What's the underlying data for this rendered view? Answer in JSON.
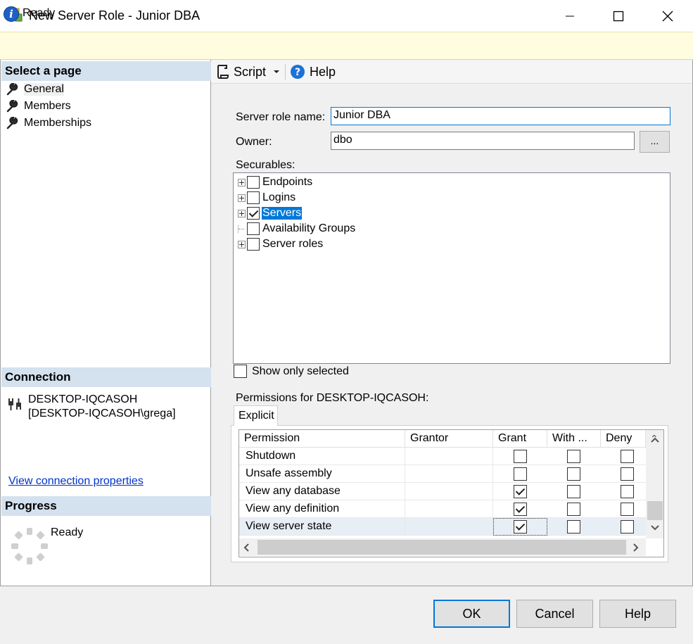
{
  "window": {
    "title": "New Server Role - Junior DBA",
    "controls": [
      "minimize",
      "maximize",
      "close"
    ]
  },
  "status": {
    "text": "Ready",
    "icon": "info-icon"
  },
  "left_panel": {
    "select_page_header": "Select a page",
    "pages": [
      {
        "label": "General",
        "icon": "wrench-icon",
        "selected": true
      },
      {
        "label": "Members",
        "icon": "wrench-icon"
      },
      {
        "label": "Memberships",
        "icon": "wrench-icon"
      }
    ],
    "connection_header": "Connection",
    "connection": {
      "server": "DESKTOP-IQCASOH",
      "user": "[DESKTOP-IQCASOH\\grega]",
      "icon": "connection-plug-icon"
    },
    "view_connection_link": "View connection properties",
    "progress_header": "Progress",
    "progress_status": "Ready"
  },
  "toolbar": {
    "script_label": "Script",
    "help_label": "Help"
  },
  "form": {
    "role_name_label": "Server role name:",
    "role_name_value": "Junior DBA",
    "owner_label": "Owner:",
    "owner_value": "dbo",
    "browse_label": "...",
    "securables_label": "Securables:",
    "securables": [
      {
        "label": "Endpoints",
        "checked": false,
        "expandable": true,
        "selected": false
      },
      {
        "label": "Logins",
        "checked": false,
        "expandable": true,
        "selected": false
      },
      {
        "label": "Servers",
        "checked": true,
        "expandable": true,
        "selected": true
      },
      {
        "label": "Availability Groups",
        "checked": false,
        "expandable": false,
        "selected": false
      },
      {
        "label": "Server roles",
        "checked": false,
        "expandable": true,
        "selected": false
      }
    ],
    "show_only_selected_label": "Show only selected",
    "show_only_selected_checked": false,
    "permissions_label": "Permissions for DESKTOP-IQCASOH:",
    "tab_label": "Explicit",
    "grid": {
      "columns": [
        "Permission",
        "Grantor",
        "Grant",
        "With ...",
        "Deny"
      ],
      "rows": [
        {
          "permission": "Shutdown",
          "grantor": "",
          "grant": false,
          "with_grant": false,
          "deny": false
        },
        {
          "permission": "Unsafe assembly",
          "grantor": "",
          "grant": false,
          "with_grant": false,
          "deny": false
        },
        {
          "permission": "View any database",
          "grantor": "",
          "grant": true,
          "with_grant": false,
          "deny": false
        },
        {
          "permission": "View any definition",
          "grantor": "",
          "grant": true,
          "with_grant": false,
          "deny": false
        },
        {
          "permission": "View server state",
          "grantor": "",
          "grant": true,
          "with_grant": false,
          "deny": false,
          "selected": true
        }
      ]
    }
  },
  "buttons": {
    "ok": "OK",
    "cancel": "Cancel",
    "help": "Help"
  },
  "colors": {
    "accent": "#0078d7",
    "section_header": "#d4e1ee",
    "status_bar": "#fffce0"
  }
}
